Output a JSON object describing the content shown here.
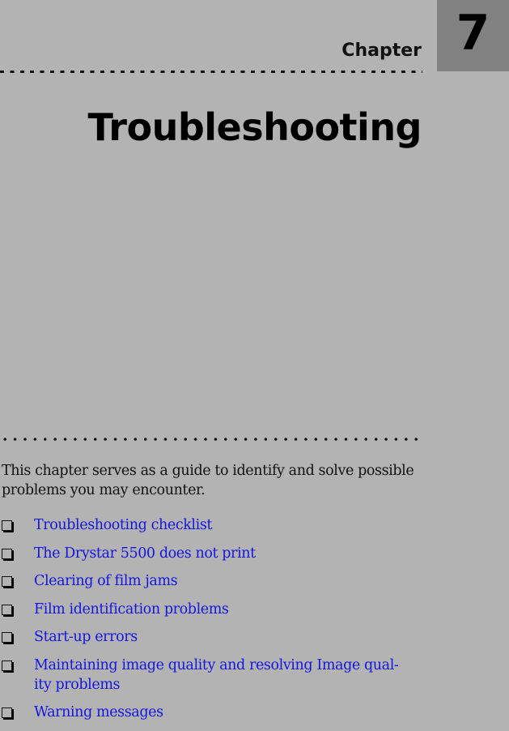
{
  "header": {
    "chapter_label": "Chapter",
    "chapter_number": "7",
    "title": "Troubleshooting"
  },
  "intro": "This chapter serves as a guide to identify and solve possible problems you may encounter.",
  "topics": [
    {
      "label": "Troubleshooting checklist",
      "icon": "checkbox-icon"
    },
    {
      "label": "The Drystar 5500 does not print",
      "icon": "checkbox-icon"
    },
    {
      "label": "Clearing of film jams",
      "icon": "checkbox-icon"
    },
    {
      "label": "Film identification problems",
      "icon": "checkbox-icon"
    },
    {
      "label": "Start-up errors",
      "icon": "checkbox-icon"
    },
    {
      "label": "Maintaining image quality and resolving Image qual-ity problems",
      "icon": "checkbox-icon"
    },
    {
      "label": "Warning messages",
      "icon": "checkbox-icon"
    }
  ],
  "colors": {
    "background": "#b3b3b3",
    "chapter_box": "#818181",
    "link": "#1515e0"
  }
}
